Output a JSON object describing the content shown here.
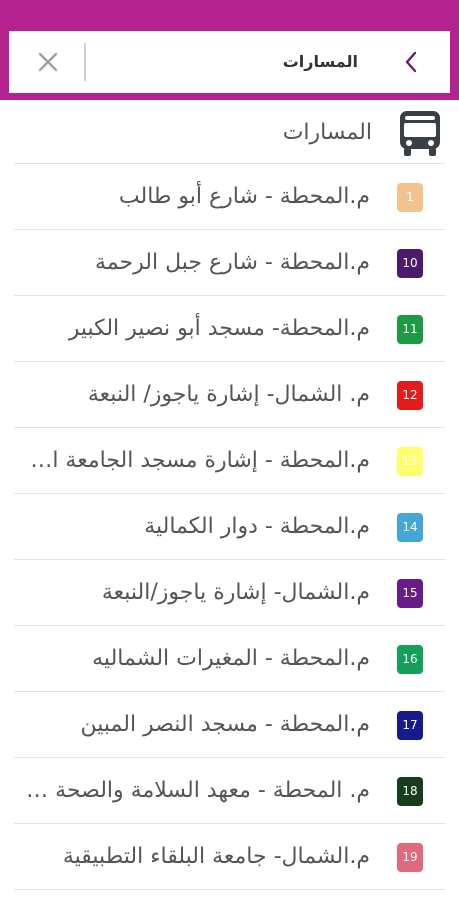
{
  "header": {
    "title": "المسارات",
    "clear_icon": "close-icon",
    "back_icon": "chevron-left-icon",
    "bar_color": "#b3238f"
  },
  "list_header": {
    "icon": "bus-icon",
    "label": "المسارات"
  },
  "routes": [
    {
      "number": "1",
      "name": "م.المحطة - شارع أبو طالب",
      "color": "#f3c38f"
    },
    {
      "number": "10",
      "name": "م.المحطة - شارع جبل الرحمة",
      "color": "#4b1a6b"
    },
    {
      "number": "11",
      "name": "م.المحطة- مسجد أبو نصير الكبير",
      "color": "#1e9a45"
    },
    {
      "number": "12",
      "name": "م. الشمال- إشارة ياجوز/ النبعة",
      "color": "#e31b1b"
    },
    {
      "number": "13",
      "name": "م.المحطة -  إشارة مسجد الجامعة الأردنية",
      "color": "#ffff6e"
    },
    {
      "number": "14",
      "name": "م.المحطة - دوار الكمالية",
      "color": "#45a7d8"
    },
    {
      "number": "15",
      "name": "م.الشمال- إشارة ياجوز/النبعة",
      "color": "#6a1b8a"
    },
    {
      "number": "16",
      "name": "م.المحطة - المغيرات الشماليه",
      "color": "#14a05a"
    },
    {
      "number": "17",
      "name": "م.المحطة -  مسجد النصر المبين",
      "color": "#161a8c"
    },
    {
      "number": "18",
      "name": "م. المحطة - معهد السلامة والصحة المهنية",
      "color": "#173d1d"
    },
    {
      "number": "19",
      "name": "م.الشمال- جامعة البلقاء التطبيقية",
      "color": "#e0697e"
    }
  ]
}
